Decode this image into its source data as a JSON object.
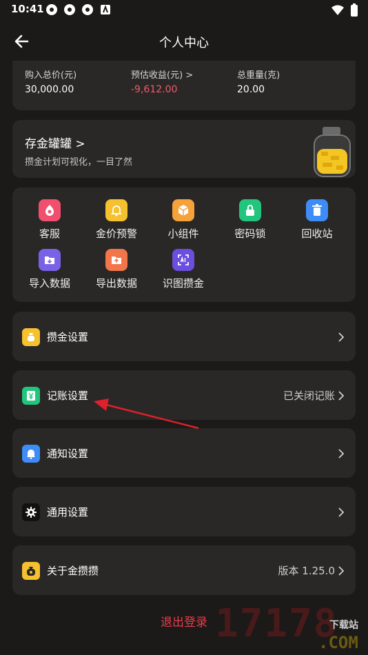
{
  "status_bar": {
    "time": "10:41"
  },
  "header": {
    "title": "个人中心"
  },
  "summary": {
    "purchase_label": "购入总价(元)",
    "purchase_value": "30,000.00",
    "profit_label": "预估收益(元) >",
    "profit_value": "-9,612.00",
    "weight_label": "总重量(克)",
    "weight_value": "20.00"
  },
  "savings_jar": {
    "title": "存金罐罐 >",
    "subtitle": "攒金计划可视化，一目了然"
  },
  "tools": [
    {
      "label": "客服",
      "icon": "support-icon",
      "color": "#f0506e"
    },
    {
      "label": "金价预警",
      "icon": "bell-alert-icon",
      "color": "#f5c12e"
    },
    {
      "label": "小组件",
      "icon": "widget-cube-icon",
      "color": "#f5a23a"
    },
    {
      "label": "密码锁",
      "icon": "lock-icon",
      "color": "#22c57d"
    },
    {
      "label": "回收站",
      "icon": "trash-icon",
      "color": "#3d8cf7"
    },
    {
      "label": "导入数据",
      "icon": "import-icon",
      "color": "#7a62e8"
    },
    {
      "label": "导出数据",
      "icon": "export-icon",
      "color": "#f2764a"
    },
    {
      "label": "识图攒金",
      "icon": "ai-scan-icon",
      "color": "#6b4ee0"
    }
  ],
  "settings": [
    {
      "label": "攒金设置",
      "value": "",
      "icon": "gold-bag-icon",
      "color": "#f5c12e"
    },
    {
      "label": "记账设置",
      "value": "已关闭记账",
      "icon": "yuan-ledger-icon",
      "color": "#22c57d"
    },
    {
      "label": "通知设置",
      "value": "",
      "icon": "bell-icon",
      "color": "#3d8cf7"
    },
    {
      "label": "通用设置",
      "value": "",
      "icon": "gear-icon",
      "color": "#111111"
    },
    {
      "label": "关于金攒攒",
      "value": "版本 1.25.0",
      "icon": "money-bag-icon",
      "color": "#f5c12e"
    }
  ],
  "logout_label": "退出登录",
  "annotation_color": "#e0202a",
  "watermark": {
    "digits": "17178",
    "site": "下载站",
    "com": ".COM"
  }
}
